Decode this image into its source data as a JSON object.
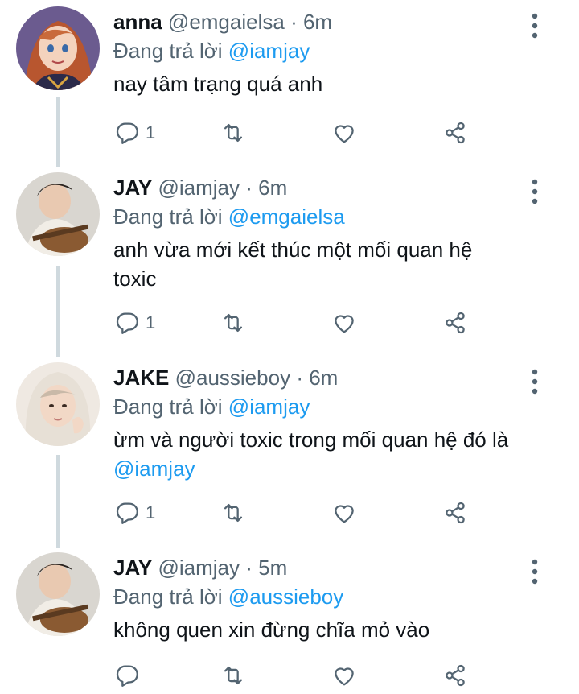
{
  "tweets": [
    {
      "name": "anna",
      "handle": "@emgaielsa",
      "time": "6m",
      "reply_prefix": "Đang trả lời",
      "reply_to": "@iamjay",
      "text_plain": "nay tâm trạng quá anh",
      "text_mention": "",
      "reply_count": "1",
      "avatar": "anna-avatar"
    },
    {
      "name": "JAY",
      "handle": "@iamjay",
      "time": "6m",
      "reply_prefix": "Đang trả lời",
      "reply_to": "@emgaielsa",
      "text_plain": "anh vừa mới kết thúc một mối quan hệ toxic",
      "text_mention": "",
      "reply_count": "1",
      "avatar": "jay-avatar"
    },
    {
      "name": "JAKE",
      "handle": "@aussieboy",
      "time": "6m",
      "reply_prefix": "Đang trả lời",
      "reply_to": "@iamjay",
      "text_plain": "ừm và người toxic trong mối quan hệ đó là ",
      "text_mention": "@iamjay",
      "reply_count": "1",
      "avatar": "jake-avatar"
    },
    {
      "name": "JAY",
      "handle": "@iamjay",
      "time": "5m",
      "reply_prefix": "Đang trả lời",
      "reply_to": "@aussieboy",
      "text_plain": "không quen xin đừng chĩa mỏ vào",
      "text_mention": "",
      "reply_count": "",
      "avatar": "jay-avatar"
    }
  ],
  "separator": "·",
  "colors": {
    "accent": "#1d9bf0",
    "muted": "#536471",
    "thread_line": "#cfd9de"
  },
  "icons": [
    "reply-icon",
    "retweet-icon",
    "like-icon",
    "share-icon",
    "more-icon"
  ]
}
